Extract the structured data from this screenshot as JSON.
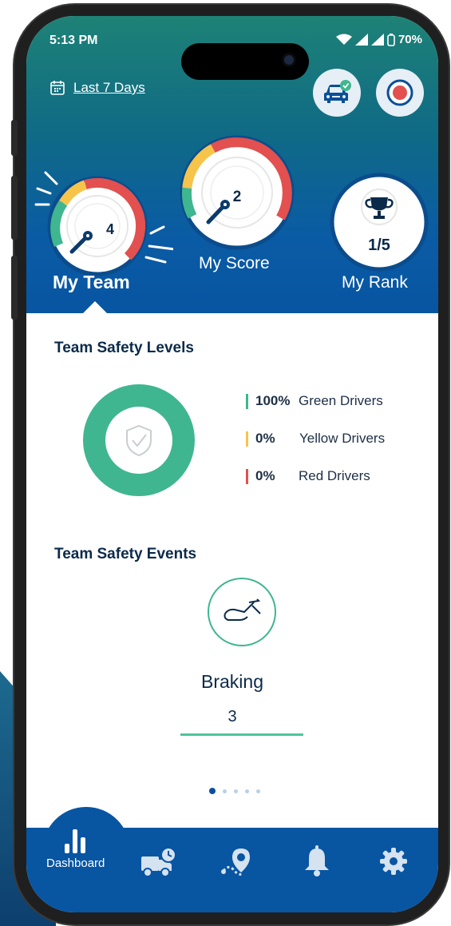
{
  "status_bar": {
    "time": "5:13 PM",
    "battery": "70%"
  },
  "header": {
    "date_filter_label": "Last 7 Days",
    "icons": {
      "date": "calendar-icon",
      "vehicle": "car-check-icon",
      "record": "record-icon"
    }
  },
  "gauges": {
    "my_team": {
      "label": "My Team",
      "value": "4"
    },
    "my_score": {
      "label": "My Score",
      "value": "2"
    },
    "my_rank": {
      "label": "My Rank",
      "value": "1/5",
      "icon": "trophy-icon"
    }
  },
  "safety_levels": {
    "title": "Team Safety Levels",
    "center_icon": "shield-check-icon",
    "levels": [
      {
        "pct": "100%",
        "label": "Green Drivers",
        "color": "#3fb68f",
        "fraction": 1.0
      },
      {
        "pct": "0%",
        "label": "Yellow Drivers",
        "color": "#f6c44a",
        "fraction": 0.0
      },
      {
        "pct": "0%",
        "label": "Red Drivers",
        "color": "#e2504f",
        "fraction": 0.0
      }
    ]
  },
  "safety_events": {
    "title": "Team Safety Events",
    "event_name": "Braking",
    "event_count": "3",
    "event_icon": "brake-pedal-icon",
    "pagination": {
      "pages": 5,
      "active": 1
    }
  },
  "tab_bar": {
    "tabs": [
      {
        "label": "Dashboard",
        "icon": "bar-chart-icon",
        "active": true
      },
      {
        "label": "",
        "icon": "truck-clock-icon"
      },
      {
        "label": "",
        "icon": "route-pin-icon"
      },
      {
        "label": "",
        "icon": "bell-icon"
      },
      {
        "label": "",
        "icon": "gear-icon"
      }
    ]
  },
  "colors": {
    "brand_blue": "#0855a2",
    "teal": "#1e8276",
    "green": "#3fb68f",
    "yellow": "#f6c44a",
    "red": "#e2504f"
  }
}
